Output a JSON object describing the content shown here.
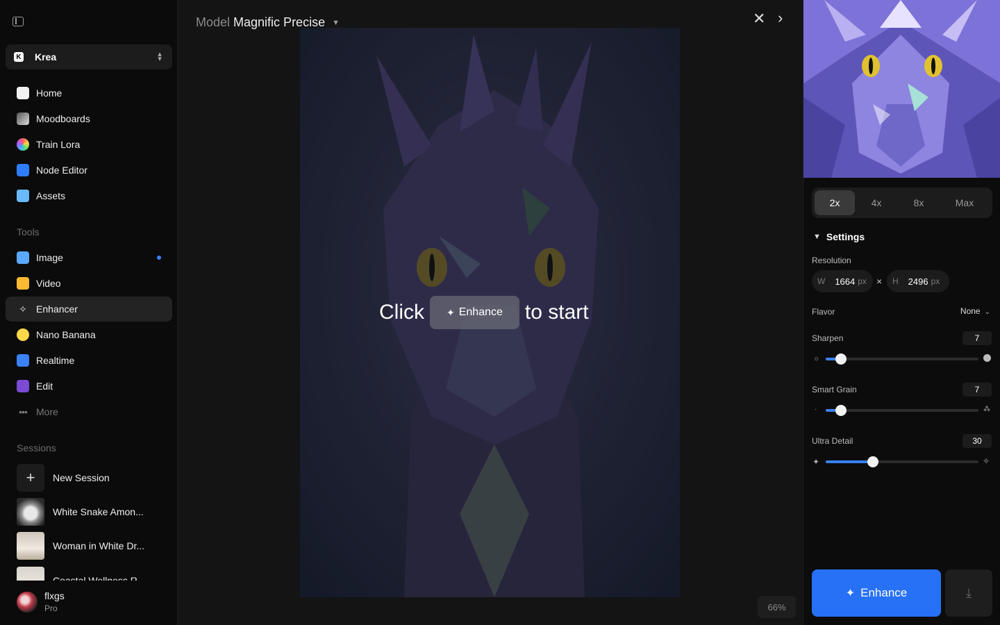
{
  "sidebar": {
    "workspace": {
      "logo": "K",
      "name": "Krea"
    },
    "nav": [
      {
        "label": "Home",
        "icon": "home-icon"
      },
      {
        "label": "Moodboards",
        "icon": "moodboard-icon"
      },
      {
        "label": "Train Lora",
        "icon": "train-lora-icon"
      },
      {
        "label": "Node Editor",
        "icon": "node-editor-icon"
      },
      {
        "label": "Assets",
        "icon": "folder-icon"
      }
    ],
    "tools_label": "Tools",
    "tools": [
      {
        "label": "Image",
        "icon": "image-icon"
      },
      {
        "label": "Video",
        "icon": "video-icon"
      },
      {
        "label": "Enhancer",
        "icon": "enhancer-icon"
      },
      {
        "label": "Nano Banana",
        "icon": "banana-icon"
      },
      {
        "label": "Realtime",
        "icon": "realtime-icon"
      },
      {
        "label": "Edit",
        "icon": "edit-icon"
      },
      {
        "label": "More",
        "icon": "more-icon"
      }
    ],
    "sessions_label": "Sessions",
    "new_session": "New Session",
    "sessions": [
      "White Snake Amon...",
      "Woman in White Dr...",
      "Coastal Wellness R..."
    ],
    "user": {
      "name": "flxgs",
      "plan": "Pro"
    }
  },
  "main": {
    "model_label": "Model",
    "model_name": "Magnific Precise",
    "cta_before": "Click",
    "cta_button": "Enhance",
    "cta_after": "to start",
    "zoom": "66%"
  },
  "panel": {
    "scales": [
      "2x",
      "4x",
      "8x",
      "Max"
    ],
    "selected_scale": "2x",
    "settings_label": "Settings",
    "resolution_label": "Resolution",
    "width": {
      "label": "W",
      "value": "1664",
      "unit": "px"
    },
    "height": {
      "label": "H",
      "value": "2496",
      "unit": "px"
    },
    "times": "×",
    "flavor_label": "Flavor",
    "flavor_value": "None",
    "sliders": [
      {
        "label": "Sharpen",
        "value": "7",
        "fraction": 0.1
      },
      {
        "label": "Smart Grain",
        "value": "7",
        "fraction": 0.1
      },
      {
        "label": "Ultra Detail",
        "value": "30",
        "fraction": 0.31
      }
    ],
    "enhance_label": "Enhance"
  },
  "colors": {
    "accent": "#2671f5",
    "active_dot": "#3b82f6"
  }
}
